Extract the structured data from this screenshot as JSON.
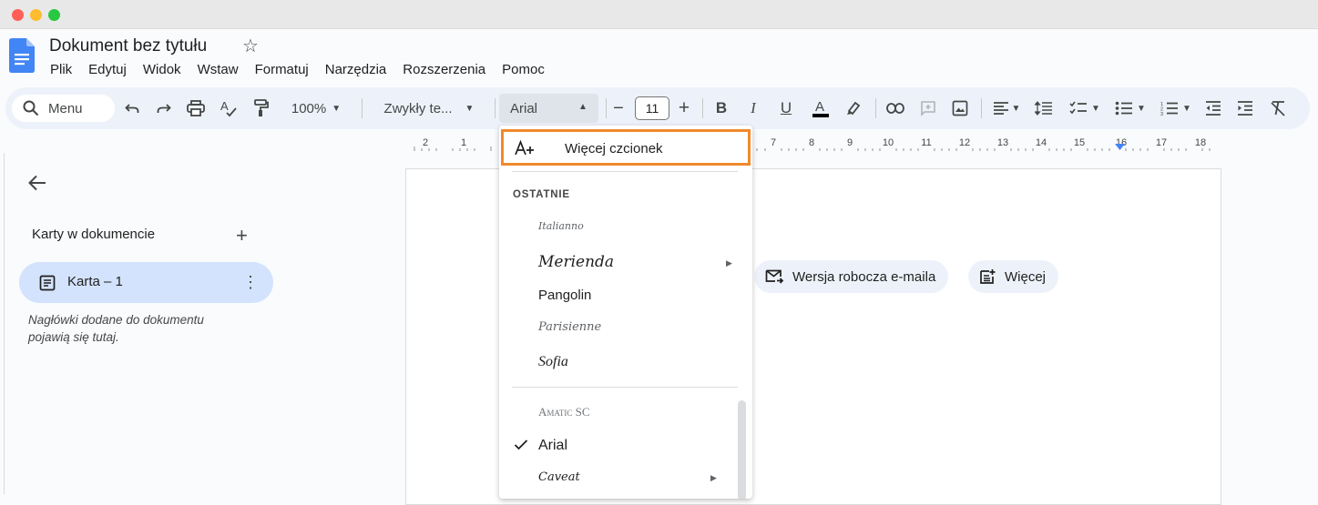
{
  "window": {
    "title": "Dokument bez tytułu"
  },
  "menu": [
    "Plik",
    "Edytuj",
    "Widok",
    "Wstaw",
    "Formatuj",
    "Narzędzia",
    "Rozszerzenia",
    "Pomoc"
  ],
  "toolbar": {
    "search_label": "Menu",
    "zoom": "100%",
    "style": "Zwykły te...",
    "font": "Arial",
    "font_size": "11"
  },
  "ruler": {
    "labels": [
      "2",
      "1",
      "7",
      "8",
      "9",
      "10",
      "11",
      "12",
      "13",
      "14",
      "15",
      "16",
      "17",
      "18"
    ]
  },
  "sidebar": {
    "header": "Karty w dokumencie",
    "tab_label": "Karta – 1",
    "note": "Nagłówki dodane do dokumentu pojawią się tutaj."
  },
  "chips": {
    "email_draft": "Wersja robocza e-maila",
    "more": "Więcej"
  },
  "font_dropdown": {
    "more_fonts": "Więcej czcionek",
    "recent_section": "OSTATNIE",
    "recent": [
      "Italianno",
      "Merienda",
      "Pangolin",
      "Parisienne",
      "Sofia"
    ],
    "all": [
      "Amatic SC",
      "Arial",
      "Caveat"
    ],
    "selected": "Arial"
  },
  "colors": {
    "accent_highlight": "#f08a2c",
    "active_tab": "#d3e3fd",
    "toolbar_bg": "#edf2fa"
  }
}
